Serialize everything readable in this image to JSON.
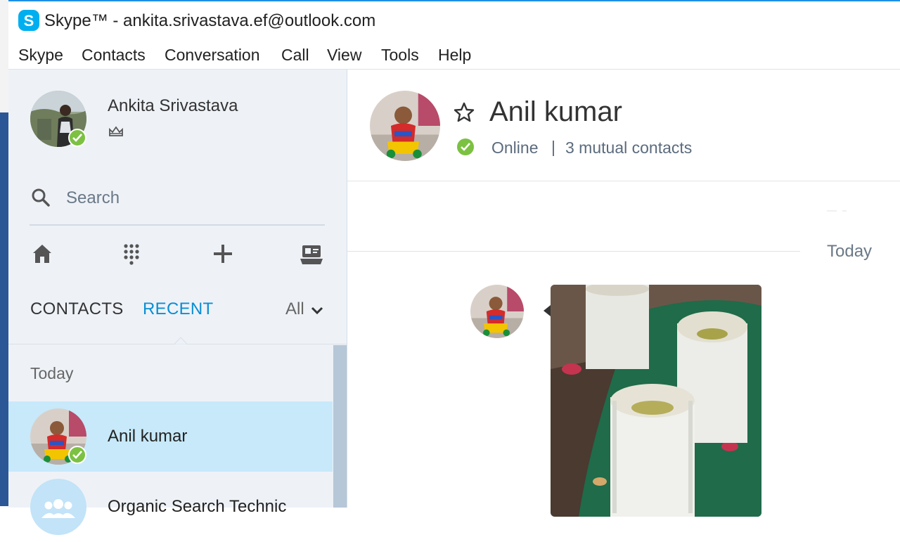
{
  "window": {
    "title": "Skype™ - ankita.srivastava.ef@outlook.com"
  },
  "menu": [
    "Skype",
    "Contacts",
    "Conversation",
    "Call",
    "View",
    "Tools",
    "Help"
  ],
  "profile": {
    "name": "Ankita Srivastava",
    "status": "online"
  },
  "search": {
    "placeholder": "Search"
  },
  "toolbar": {
    "icons": [
      "home-icon",
      "dialpad-icon",
      "add-icon",
      "contact-card-icon"
    ]
  },
  "tabs": {
    "contacts": "CONTACTS",
    "recent": "RECENT",
    "active": "recent",
    "filter": "All"
  },
  "recent": {
    "section": "Today",
    "items": [
      {
        "name": "Anil kumar",
        "status": "online",
        "selected": true
      },
      {
        "name": "Organic Search Technic",
        "type": "group"
      }
    ]
  },
  "conversation": {
    "name": "Anil kumar",
    "status": "Online",
    "separator": "|",
    "mutual": "3 mutual contacts",
    "date_label": "Today"
  },
  "colors": {
    "accent": "#0a8ed4",
    "online": "#7cc142",
    "selected_row": "#c7e9fa",
    "sidebar_bg": "#eef2f7"
  }
}
